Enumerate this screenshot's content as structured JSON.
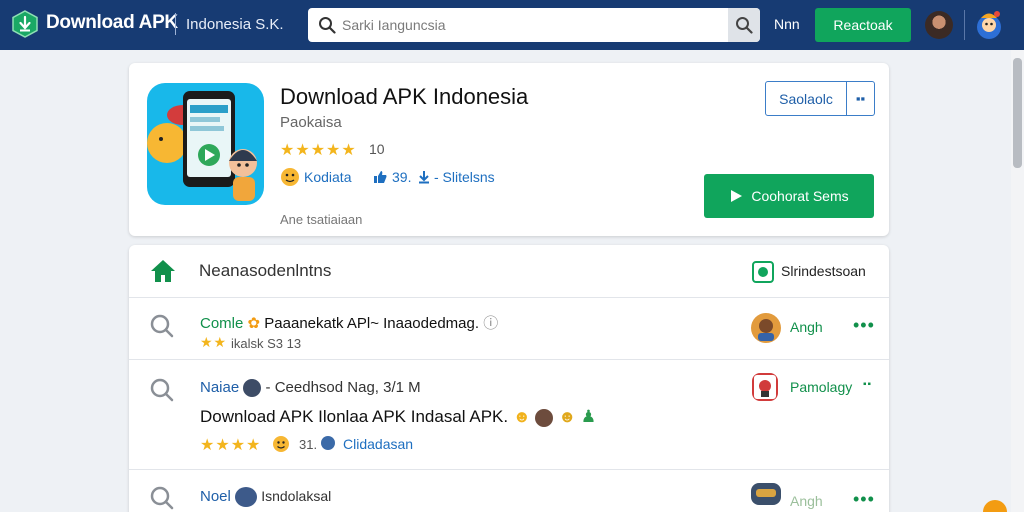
{
  "header": {
    "brand": "Download APK",
    "brand_sub": "Indonesia S.K.",
    "search_placeholder": "Sarki Ianguncsia",
    "nav_link": "Nnn",
    "nav_button": "Reactoak"
  },
  "app": {
    "title": "Download APK Indonesia",
    "developer": "Paokaisa",
    "stars": "★★★★★",
    "rating": "10",
    "meta_1": "Kodiata",
    "meta_2": "39.",
    "meta_3": "- Slitelsns",
    "note": "Ane tsatiaiaan",
    "split_label": "Saolaolc",
    "split_caret": "▪▪",
    "download_label": "Coohorat Sems",
    "accent": "#10a55c",
    "nav_bg": "#173b73"
  },
  "list": {
    "title": "Neanasodenlntns",
    "subscribe": "Slrindestsoan",
    "rows": [
      {
        "title_green": "Comle",
        "title": "Paaanekatk APl~ Inaaodedmag.",
        "stars": "★★",
        "sub": "ikalsk   S3 13",
        "action": "Angh",
        "more": "•••"
      },
      {
        "title_green": "",
        "title": "Naiae",
        "title_suffix": "- Ceedhsod Nag, 3/1 M",
        "desc": "Download APK Ilonlaa APK Indasal APK.",
        "stars": "★★★★",
        "sub": "31.",
        "sub_link": "Clidadasan",
        "action": "Pamolagy",
        "more": "▪▪"
      },
      {
        "title": "Noel",
        "title_suffix": "Isndolaksal",
        "action": "Angh",
        "more": "•••"
      }
    ]
  }
}
